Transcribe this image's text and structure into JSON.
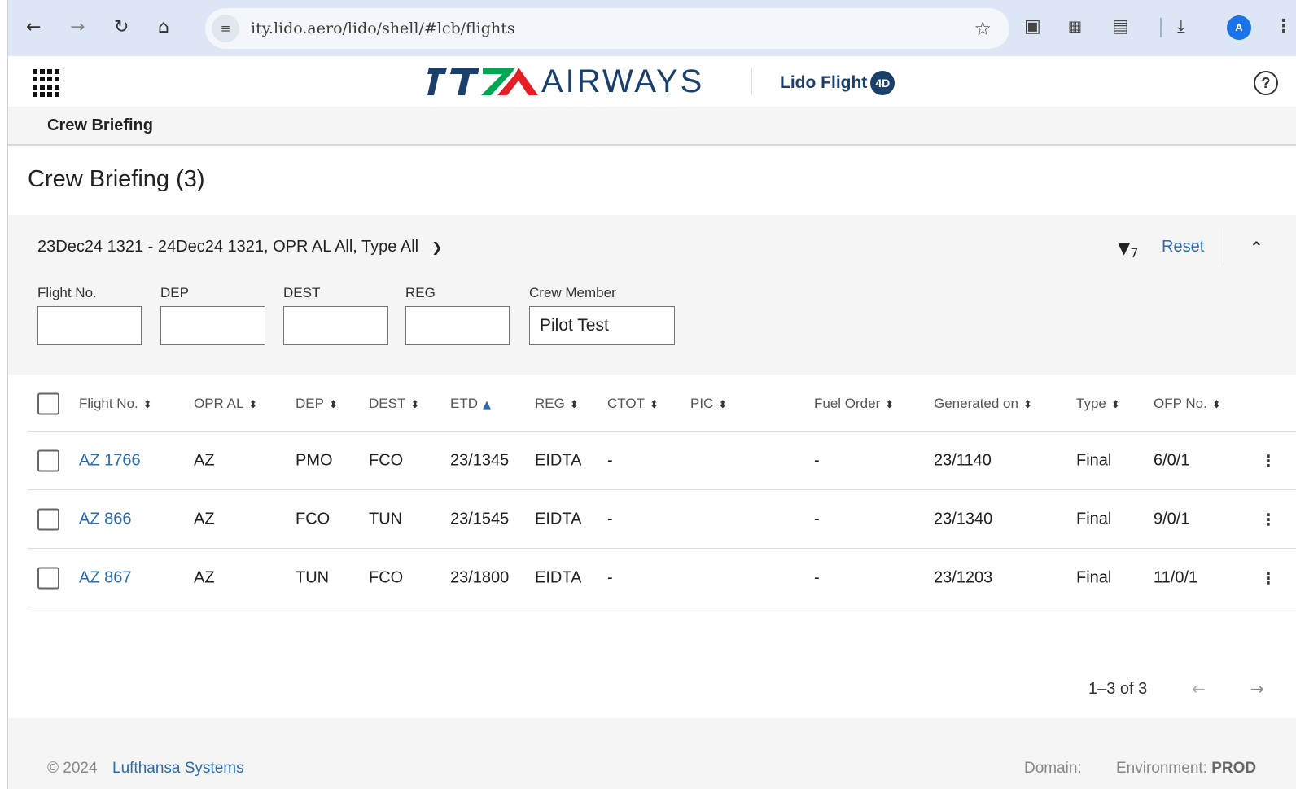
{
  "browser": {
    "url": "ity.lido.aero/lido/shell/#lcb/flights",
    "profile_initial": "A",
    "nav_icons": [
      "back-icon",
      "forward-icon",
      "reload-icon",
      "home-icon"
    ]
  },
  "header": {
    "brand_text": "AIRWAYS",
    "product_name": "Lido Flight",
    "product_badge": "4D",
    "help_symbol": "?"
  },
  "subnav": {
    "title": "Crew Briefing"
  },
  "page": {
    "title": "Crew Briefing (3)"
  },
  "filters": {
    "summary": "23Dec24 1321 - 24Dec24 1321, OPR AL All, Type All",
    "active_count": "7",
    "reset_label": "Reset",
    "fields": [
      {
        "label": "Flight No.",
        "value": ""
      },
      {
        "label": "DEP",
        "value": ""
      },
      {
        "label": "DEST",
        "value": ""
      },
      {
        "label": "REG",
        "value": ""
      },
      {
        "label": "Crew Member",
        "value": "Pilot Test"
      }
    ]
  },
  "table": {
    "columns": [
      "Flight No.",
      "OPR AL",
      "DEP",
      "DEST",
      "ETD",
      "REG",
      "CTOT",
      "PIC",
      "Fuel Order",
      "Generated on",
      "Type",
      "OFP No."
    ],
    "sorted_column": "ETD",
    "sort_direction": "ascending",
    "rows": [
      {
        "flight": "AZ 1766",
        "opr": "AZ",
        "dep": "PMO",
        "dest": "FCO",
        "etd": "23/1345",
        "reg": "EIDTA",
        "ctot": "-",
        "pic": "",
        "fuel": "-",
        "generated": "23/1140",
        "type": "Final",
        "ofp": "6/0/1"
      },
      {
        "flight": "AZ 866",
        "opr": "AZ",
        "dep": "FCO",
        "dest": "TUN",
        "etd": "23/1545",
        "reg": "EIDTA",
        "ctot": "-",
        "pic": "",
        "fuel": "-",
        "generated": "23/1340",
        "type": "Final",
        "ofp": "9/0/1"
      },
      {
        "flight": "AZ 867",
        "opr": "AZ",
        "dep": "TUN",
        "dest": "FCO",
        "etd": "23/1800",
        "reg": "EIDTA",
        "ctot": "-",
        "pic": "",
        "fuel": "-",
        "generated": "23/1203",
        "type": "Final",
        "ofp": "11/0/1"
      }
    ]
  },
  "pagination": {
    "range": "1–3 of 3"
  },
  "footer": {
    "copyright": "© 2024",
    "company": "Lufthansa Systems",
    "domain_label": "Domain:",
    "environment_label": "Environment:",
    "environment_value": "PROD"
  },
  "colors": {
    "brand_navy": "#1b3f6b",
    "brand_green": "#00a651",
    "brand_red": "#e31e24",
    "link": "#2b6cb0"
  }
}
